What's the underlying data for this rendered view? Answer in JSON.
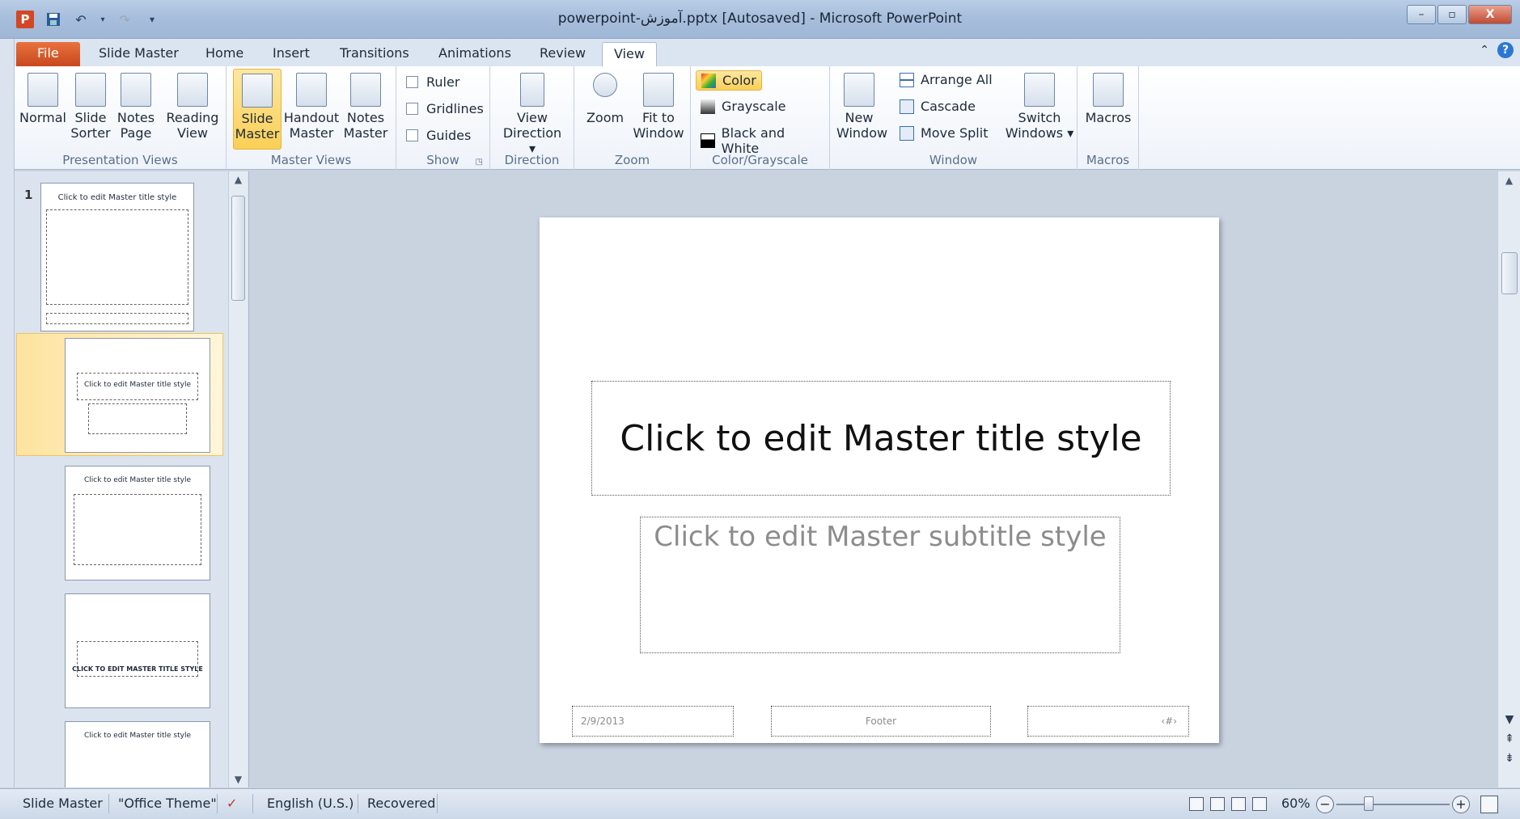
{
  "window": {
    "title": "powerpoint-آموزش.pptx [Autosaved]  -  Microsoft PowerPoint",
    "app_icon": "P",
    "controls": {
      "minimize": "–",
      "maximize": "▫",
      "close": "X"
    }
  },
  "tabs": [
    "File",
    "Slide Master",
    "Home",
    "Insert",
    "Transitions",
    "Animations",
    "Review",
    "View"
  ],
  "active_tab": "View",
  "ribbon": {
    "presentation_views": {
      "label": "Presentation Views",
      "buttons": [
        {
          "line1": "Normal",
          "line2": ""
        },
        {
          "line1": "Slide",
          "line2": "Sorter"
        },
        {
          "line1": "Notes",
          "line2": "Page"
        },
        {
          "line1": "Reading",
          "line2": "View"
        }
      ]
    },
    "master_views": {
      "label": "Master Views",
      "buttons": [
        {
          "line1": "Slide",
          "line2": "Master"
        },
        {
          "line1": "Handout",
          "line2": "Master"
        },
        {
          "line1": "Notes",
          "line2": "Master"
        }
      ]
    },
    "show": {
      "label": "Show",
      "checkboxes": [
        "Ruler",
        "Gridlines",
        "Guides"
      ]
    },
    "direction": {
      "label": "Direction",
      "button": {
        "line1": "View",
        "line2": "Direction ▾"
      }
    },
    "zoom": {
      "label": "Zoom",
      "buttons": [
        {
          "line1": "Zoom",
          "line2": ""
        },
        {
          "line1": "Fit to",
          "line2": "Window"
        }
      ]
    },
    "color": {
      "label": "Color/Grayscale",
      "items": [
        "Color",
        "Grayscale",
        "Black and White"
      ]
    },
    "window": {
      "label": "Window",
      "new_window": {
        "line1": "New",
        "line2": "Window"
      },
      "items": [
        "Arrange All",
        "Cascade",
        "Move Split"
      ],
      "switch": {
        "line1": "Switch",
        "line2": "Windows ▾"
      }
    },
    "macros": {
      "label": "Macros",
      "button": "Macros"
    }
  },
  "thumbnails": {
    "number": "1",
    "master_title": "Click to edit Master title style",
    "thumb2_title": "Click to edit Master title style",
    "thumb3_title": "Click to edit Master title style",
    "thumb4_title": "CLICK TO EDIT MASTER TITLE STYLE",
    "thumb5_title": "Click to edit Master title style"
  },
  "slide": {
    "title": "Click to edit Master title style",
    "subtitle": "Click to edit Master subtitle style",
    "date": "2/9/2013",
    "footer": "Footer",
    "number": "‹#›"
  },
  "statusbar": {
    "view": "Slide Master",
    "theme": "\"Office Theme\"",
    "language": "English (U.S.)",
    "state": "Recovered",
    "zoom": "60%",
    "zoom_level_percent": 60
  }
}
